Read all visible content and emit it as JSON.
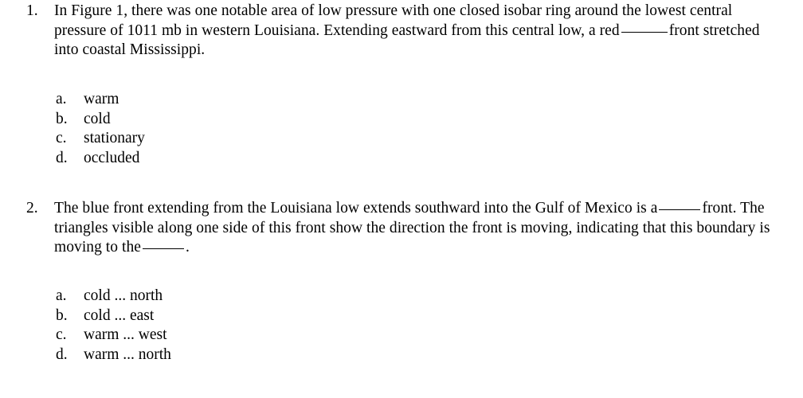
{
  "document": {
    "background_color": "#ffffff",
    "text_color": "#000000",
    "questions": [
      {
        "number": "1.",
        "text_part_1": "In Figure 1, there was one notable area of low pressure with one closed isobar ring around the lowest central pressure of 1011 mb in western Louisiana. Extending eastward from this central low, a red",
        "text_part_2": "front stretched into coastal Mississippi.",
        "options": [
          {
            "letter": "a.",
            "label": "warm"
          },
          {
            "letter": "b.",
            "label": "cold"
          },
          {
            "letter": "c.",
            "label": "stationary"
          },
          {
            "letter": "d.",
            "label": "occluded"
          }
        ]
      },
      {
        "number": "2.",
        "text_part_1": "The blue front extending from the Louisiana low extends southward into the Gulf of Mexico is a",
        "text_part_2": "front. The triangles visible along one side of this front show the direction the front is moving, indicating that this boundary is moving to the",
        "text_part_3": ".",
        "options": [
          {
            "letter": "a.",
            "label": "cold ... north"
          },
          {
            "letter": "b.",
            "label": "cold ... east"
          },
          {
            "letter": "c.",
            "label": "warm ... west"
          },
          {
            "letter": "d.",
            "label": "warm ... north"
          }
        ]
      }
    ]
  }
}
